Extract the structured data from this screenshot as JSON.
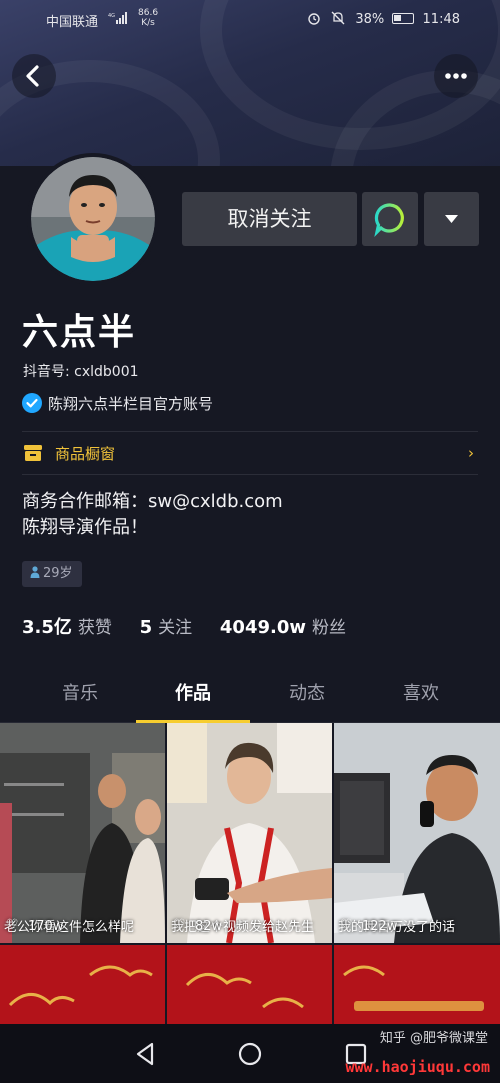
{
  "status_bar": {
    "carrier": "中国联通",
    "network": "4G",
    "speed_value": "86.6",
    "speed_unit": "K/s",
    "battery": "38%",
    "time": "11:48"
  },
  "header": {
    "back_icon": "back-arrow-icon",
    "more_icon": "more-dots-icon"
  },
  "profile": {
    "name": "六点半",
    "douyin_id": "抖音号: cxldb001",
    "verified_text": "陈翔六点半栏目官方账号",
    "follow_button_label": "取消关注",
    "shop_label": "商品橱窗",
    "bio_lines": [
      "商务合作邮箱：sw@cxldb.com",
      "陈翔导演作品！"
    ],
    "age_tag": "29岁",
    "stats": [
      {
        "value": "3.5亿",
        "label": "获赞"
      },
      {
        "value": "5",
        "label": "关注"
      },
      {
        "value": "4049.0w",
        "label": "粉丝"
      }
    ]
  },
  "tabs": [
    {
      "label": "音乐",
      "active": false
    },
    {
      "label": "作品",
      "active": true
    },
    {
      "label": "动态",
      "active": false
    },
    {
      "label": "喜欢",
      "active": false
    }
  ],
  "videos": [
    {
      "caption": "老公你看这件怎么样呢",
      "likes": "170w"
    },
    {
      "caption": "我把这个视频发给赵先生",
      "likes": "82w"
    },
    {
      "caption": "我的两百万没了的话",
      "likes": "122w"
    }
  ],
  "watermark": {
    "line1": "知乎 @肥爷微课堂",
    "line2": "www.haojiuqu.com"
  },
  "colors": {
    "background": "#161823",
    "accent_yellow": "#f7cd2f",
    "verified_blue": "#20a7ff",
    "shop_yellow": "#f0c23a"
  }
}
